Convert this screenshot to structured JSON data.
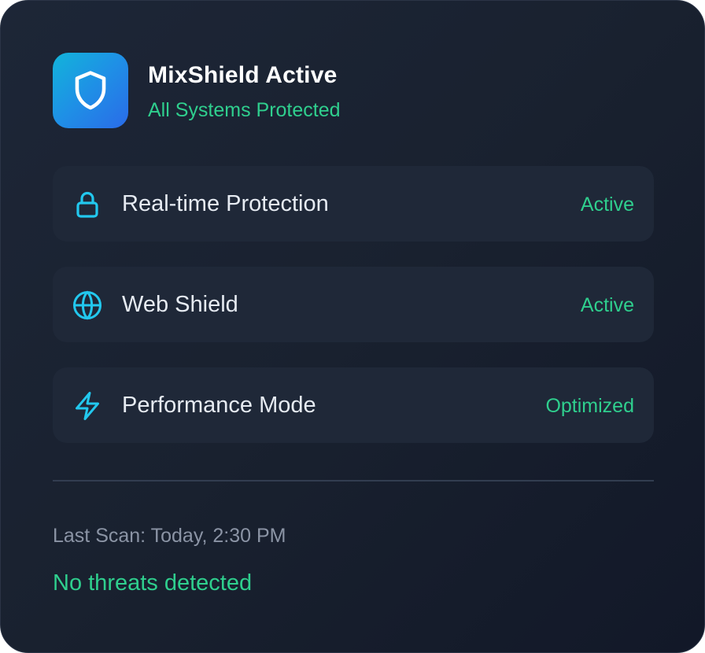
{
  "header": {
    "title": "MixShield Active",
    "subtitle": "All Systems Protected",
    "icon": "shield-icon"
  },
  "features": [
    {
      "icon": "lock-icon",
      "label": "Real-time Protection",
      "status": "Active"
    },
    {
      "icon": "globe-icon",
      "label": "Web Shield",
      "status": "Active"
    },
    {
      "icon": "lightning-icon",
      "label": "Performance Mode",
      "status": "Optimized"
    }
  ],
  "footer": {
    "last_scan": "Last Scan: Today, 2:30 PM",
    "threat_status": "No threats detected"
  },
  "colors": {
    "accent": "#2fcf8e",
    "icon_stroke": "#22c8ee",
    "brand_gradient_start": "#12b4da",
    "brand_gradient_end": "#2a6be8"
  }
}
